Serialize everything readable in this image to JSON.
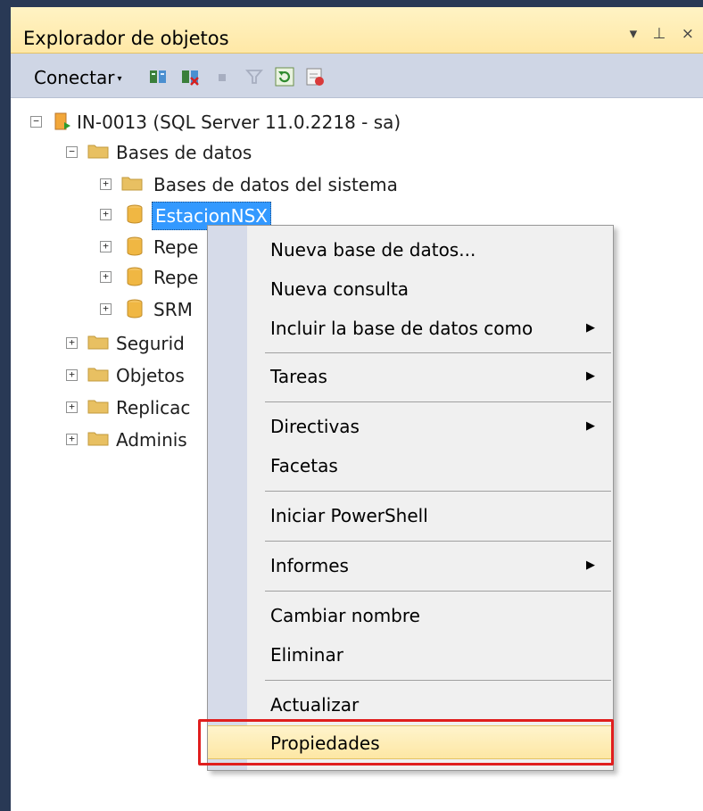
{
  "panel": {
    "title": "Explorador de objetos",
    "controls": "▾ ⊥ ×"
  },
  "toolbar": {
    "connect_label": "Conectar",
    "connect_arrow": "▾"
  },
  "tree": {
    "server": "IN-0013 (SQL Server 11.0.2218 - sa)",
    "databases_folder": "Bases de datos",
    "system_databases": "Bases de datos del sistema",
    "selected_db": "EstacionNSX",
    "db_repe1": "Repe",
    "db_repe2": "Repe",
    "db_srm": "SRM",
    "security": "Segurid",
    "objects": "Objetos",
    "replication": "Replicac",
    "admin": "Adminis"
  },
  "context_menu": {
    "items": [
      {
        "label": "Nueva base de datos..."
      },
      {
        "label": "Nueva consulta"
      },
      {
        "label": "Incluir la base de datos como",
        "submenu": "▶"
      },
      {
        "label": "Tareas",
        "submenu": "▶"
      },
      {
        "label": "Directivas",
        "submenu": "▶"
      },
      {
        "label": "Facetas"
      },
      {
        "label": "Iniciar PowerShell"
      },
      {
        "label": "Informes",
        "submenu": "▶"
      },
      {
        "label": "Cambiar nombre"
      },
      {
        "label": "Eliminar"
      },
      {
        "label": "Actualizar"
      },
      {
        "label": "Propiedades"
      }
    ]
  },
  "colors": {
    "accent": "#3399ff",
    "highlight_box": "#e01e1e",
    "titlebar": "#ffe8a6"
  }
}
